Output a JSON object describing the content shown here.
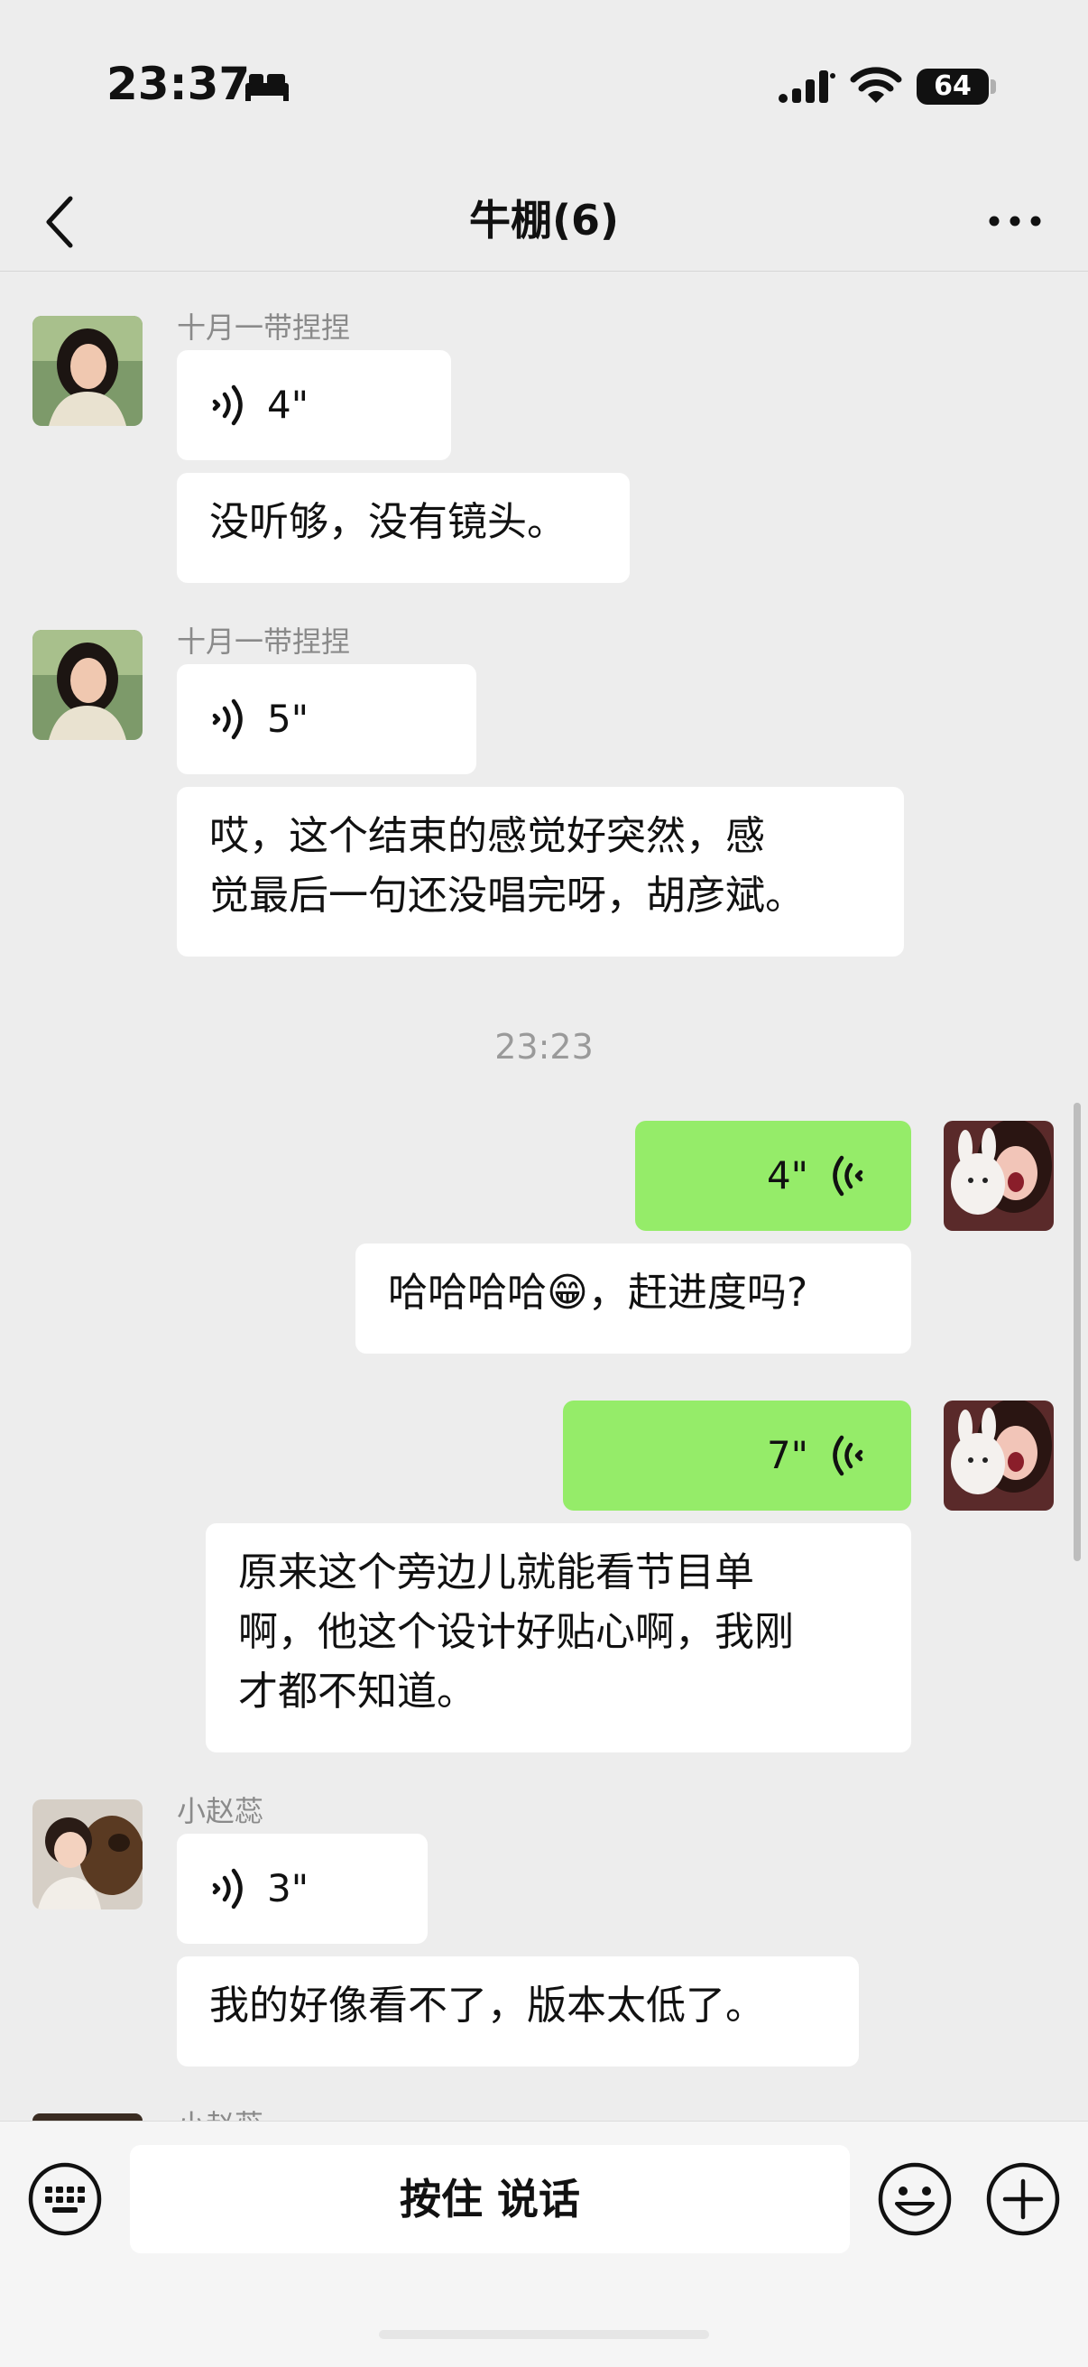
{
  "status_bar": {
    "time": "23:37",
    "battery": "64"
  },
  "nav": {
    "title": "牛棚(6)"
  },
  "messages": [
    {
      "sender": "十月一带捏捏",
      "voice": "4\"",
      "text": "没听够，没有镜头。"
    },
    {
      "sender": "十月一带捏捏",
      "voice": "5\"",
      "text_lines": [
        "哎，这个结束的感觉好突然，感",
        "觉最后一句还没唱完呀，胡彦斌。"
      ]
    },
    {
      "timestamp": "23:23"
    },
    {
      "self": true,
      "voice": "4\"",
      "text_before": "哈哈哈哈",
      "emoji": "😁",
      "text_after": "，赶进度吗?"
    },
    {
      "self": true,
      "voice": "7\"",
      "text_lines": [
        "原来这个旁边儿就能看节目单",
        "啊，他这个设计好贴心啊，我刚",
        "才都不知道。"
      ]
    },
    {
      "sender": "小赵蕊",
      "voice": "3\"",
      "text": "我的好像看不了，版本太低了。"
    },
    {
      "sender": "小赵蕊"
    }
  ],
  "input_bar": {
    "hold_to_talk": "按住 说话"
  },
  "colors": {
    "background": "#ededed",
    "self_bubble": "#95ec69",
    "other_bubble": "#ffffff"
  }
}
